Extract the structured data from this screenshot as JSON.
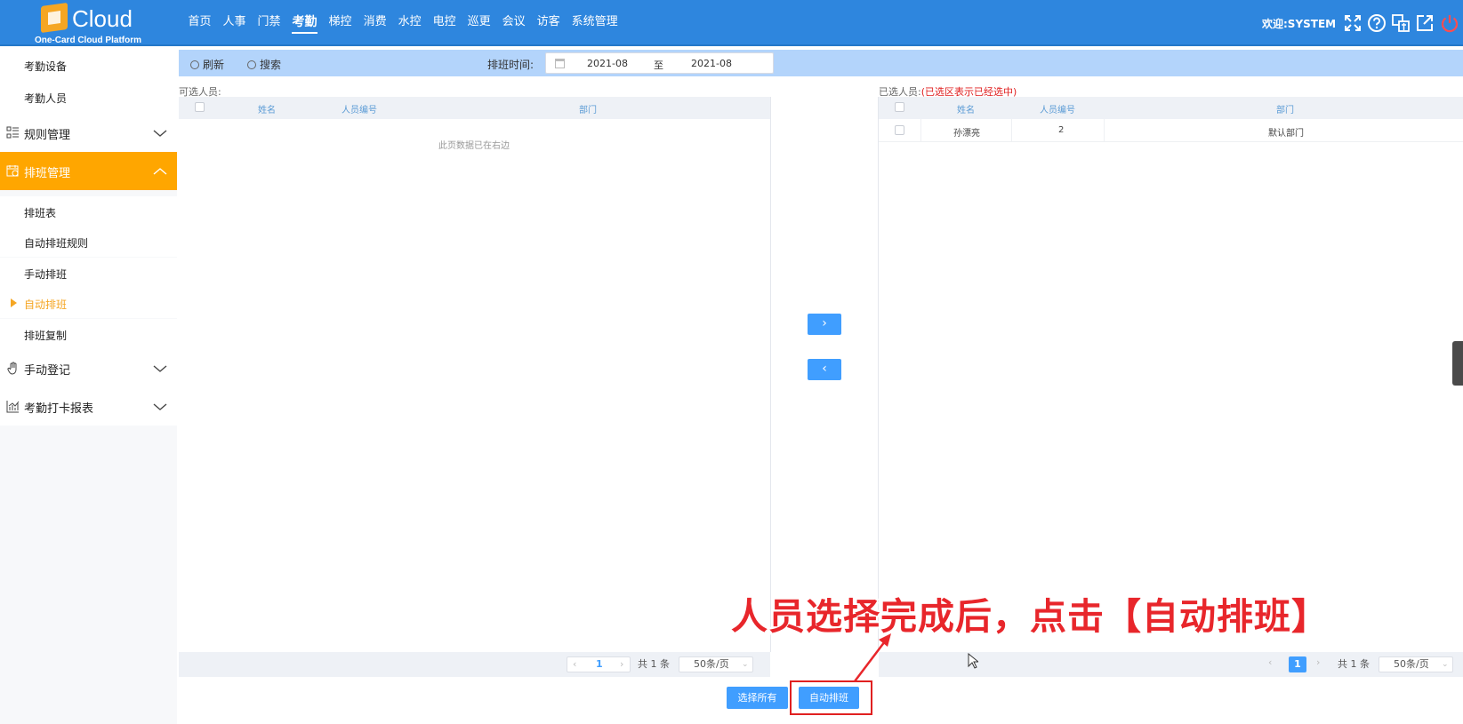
{
  "header": {
    "brand": "Cloud",
    "subtitle": "One-Card Cloud Platform",
    "nav": [
      "首页",
      "人事",
      "门禁",
      "考勤",
      "梯控",
      "消费",
      "水控",
      "电控",
      "巡更",
      "会议",
      "访客",
      "系统管理"
    ],
    "active_nav": "考勤",
    "welcome": "欢迎:SYSTEM",
    "icons": [
      "fullscreen-icon",
      "help-icon",
      "language-icon",
      "external-link-icon",
      "power-icon"
    ]
  },
  "sidebar": {
    "top_items": [
      "考勤设备",
      "考勤人员"
    ],
    "groups": [
      {
        "label": "规则管理",
        "icon": "rules-icon"
      },
      {
        "label": "排班管理",
        "icon": "schedule-icon"
      },
      {
        "label": "手动登记",
        "icon": "hand-icon"
      },
      {
        "label": "考勤打卡报表",
        "icon": "chart-icon"
      }
    ],
    "schedule_sub": [
      "排班表",
      "自动排班规则",
      "手动排班",
      "自动排班",
      "排班复制"
    ],
    "active_sub": "自动排班"
  },
  "toolbar": {
    "refresh": "刷新",
    "search": "搜索",
    "date_label": "排班时间:",
    "date_from": "2021-08",
    "date_sep": "至",
    "date_to": "2021-08"
  },
  "left_panel": {
    "title": "可选人员:",
    "columns": [
      "姓名",
      "人员编号",
      "部门"
    ],
    "empty_text": "此页数据已在右边",
    "pager": {
      "page": "1",
      "total": "共 1 条",
      "page_size": "50条/页"
    }
  },
  "right_panel": {
    "title": "已选人员:",
    "note": "(已选区表示已经选中)",
    "columns": [
      "姓名",
      "人员编号",
      "部门"
    ],
    "rows": [
      {
        "name": "孙漂亮",
        "id": "2",
        "dept": "默认部门"
      }
    ],
    "pager": {
      "page": "1",
      "total": "共 1 条",
      "page_size": "50条/页"
    }
  },
  "transfer": {
    "to_right": "›",
    "to_left": "‹"
  },
  "actions": {
    "select_all": "选择所有",
    "auto_schedule": "自动排班"
  },
  "annotation": "人员选择完成后，点击【自动排班】",
  "colors": {
    "header_bg": "#2e86de",
    "active_group": "#ffa600",
    "primary": "#409eff",
    "annotation_red": "#e8262b"
  }
}
